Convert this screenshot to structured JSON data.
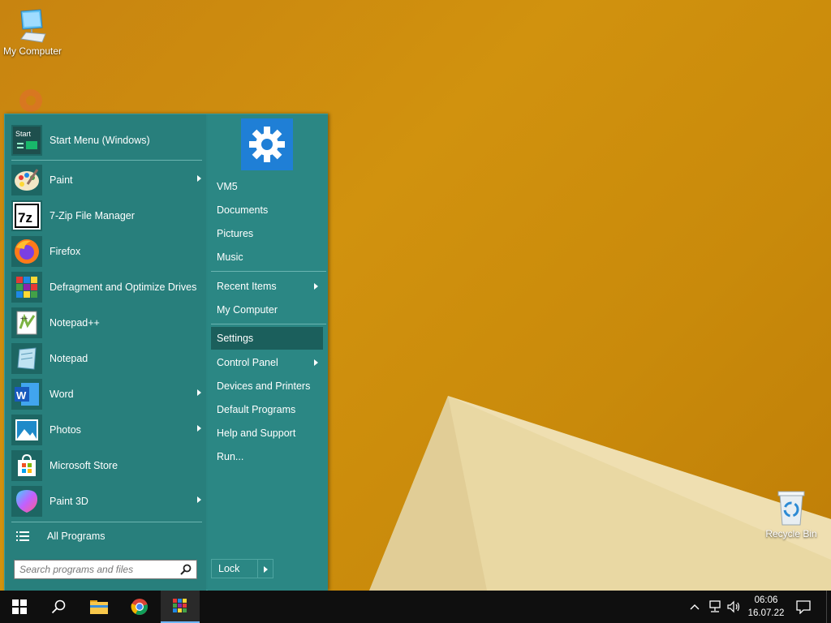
{
  "desktop": {
    "icons": [
      {
        "label": "My Computer",
        "icon": "computer-icon"
      },
      {
        "label": "Recycle Bin",
        "icon": "recycle-bin-icon"
      }
    ]
  },
  "start_menu": {
    "pinned": [
      {
        "label": "Start Menu (Windows)",
        "icon": "start-menu-icon",
        "submenu": false
      },
      {
        "label": "Paint",
        "icon": "paint-icon",
        "submenu": true
      },
      {
        "label": "7-Zip File Manager",
        "icon": "7zip-icon",
        "submenu": false
      },
      {
        "label": "Firefox",
        "icon": "firefox-icon",
        "submenu": false
      },
      {
        "label": "Defragment and Optimize Drives",
        "icon": "defrag-icon",
        "submenu": false
      },
      {
        "label": "Notepad++",
        "icon": "notepadpp-icon",
        "submenu": false
      },
      {
        "label": "Notepad",
        "icon": "notepad-icon",
        "submenu": false
      },
      {
        "label": "Word",
        "icon": "word-icon",
        "submenu": true
      },
      {
        "label": "Photos",
        "icon": "photos-icon",
        "submenu": true
      },
      {
        "label": "Microsoft Store",
        "icon": "store-icon",
        "submenu": false
      },
      {
        "label": "Paint 3D",
        "icon": "paint3d-icon",
        "submenu": true
      }
    ],
    "all_programs": "All Programs",
    "search_placeholder": "Search programs and files",
    "right": [
      {
        "label": "VM5",
        "submenu": false
      },
      {
        "label": "Documents",
        "submenu": false
      },
      {
        "label": "Pictures",
        "submenu": false
      },
      {
        "label": "Music",
        "submenu": false
      },
      {
        "label": "Recent Items",
        "submenu": true
      },
      {
        "label": "My Computer",
        "submenu": false
      },
      {
        "label": "Settings",
        "submenu": false,
        "selected": true
      },
      {
        "label": "Control Panel",
        "submenu": true
      },
      {
        "label": "Devices and Printers",
        "submenu": false
      },
      {
        "label": "Default Programs",
        "submenu": false
      },
      {
        "label": "Help and Support",
        "submenu": false
      },
      {
        "label": "Run...",
        "submenu": false
      }
    ],
    "lock_label": "Lock"
  },
  "taskbar": {
    "time": "06:06",
    "date": "16.07.22"
  },
  "colors": {
    "menu_bg": "#2a8582",
    "selected": "#1b5f5c",
    "taskbar": "#0f0f0f",
    "desktop": "#d08d0c",
    "settings_tile": "#1f7fd6"
  }
}
